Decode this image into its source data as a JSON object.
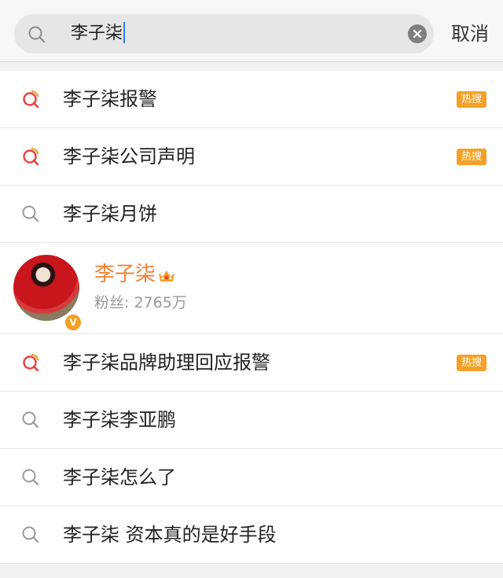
{
  "search": {
    "query": "李子柒",
    "cancel_label": "取消"
  },
  "results": [
    {
      "text": "李子柒报警",
      "icon": "hot-search-icon",
      "badge": "热搜"
    },
    {
      "text": "李子柒公司声明",
      "icon": "hot-search-icon",
      "badge": "热搜"
    },
    {
      "text": "李子柒月饼",
      "icon": "search-icon",
      "badge": ""
    },
    {
      "text": "李子柒品牌助理回应报警",
      "icon": "hot-search-icon",
      "badge": "热搜"
    },
    {
      "text": "李子柒李亚鹏",
      "icon": "search-icon",
      "badge": ""
    },
    {
      "text": "李子柒怎么了",
      "icon": "search-icon",
      "badge": ""
    },
    {
      "text": "李子柒 资本真的是好手段",
      "icon": "search-icon",
      "badge": ""
    }
  ],
  "user": {
    "name": "李子柒",
    "fans_label": "粉丝:",
    "fans_count": "2765万",
    "verified_mark": "V"
  },
  "colors": {
    "accent_orange": "#f4a128",
    "username_orange": "#f28030",
    "hot_icon_red": "#e8403e"
  }
}
